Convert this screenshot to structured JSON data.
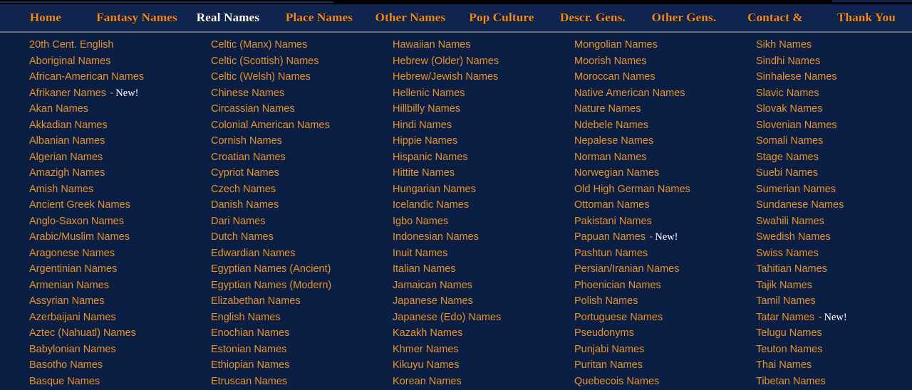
{
  "nav": {
    "items": [
      {
        "label": "Home",
        "active": false
      },
      {
        "label": "Fantasy Names",
        "active": false
      },
      {
        "label": "Real Names",
        "active": true
      },
      {
        "label": "Place Names",
        "active": false
      },
      {
        "label": "Other Names",
        "active": false
      },
      {
        "label": "Pop Culture",
        "active": false
      },
      {
        "label": "Descr. Gens.",
        "active": false
      },
      {
        "label": "Other Gens.",
        "active": false
      },
      {
        "label": "Contact &",
        "active": false
      },
      {
        "label": "Thank You",
        "active": false
      }
    ]
  },
  "colors": {
    "page_background": "#0b1f44",
    "nav_background": "#0f2550",
    "link_orange": "#e8922a",
    "nav_orange": "#f08a1e",
    "active_white": "#ffffff",
    "separator_grey": "#6b6f78",
    "top_strip_black": "#000000"
  },
  "badges": {
    "new_label": "New!",
    "dash": "-"
  },
  "columns": [
    {
      "links": [
        {
          "label": "20th Cent. English",
          "new": false
        },
        {
          "label": "Aboriginal Names",
          "new": false
        },
        {
          "label": "African-American Names",
          "new": false
        },
        {
          "label": "Afrikaner Names",
          "new": true
        },
        {
          "label": "Akan Names",
          "new": false
        },
        {
          "label": "Akkadian Names",
          "new": false
        },
        {
          "label": "Albanian Names",
          "new": false
        },
        {
          "label": "Algerian Names",
          "new": false
        },
        {
          "label": "Amazigh Names",
          "new": false
        },
        {
          "label": "Amish Names",
          "new": false
        },
        {
          "label": "Ancient Greek Names",
          "new": false
        },
        {
          "label": "Anglo-Saxon Names",
          "new": false
        },
        {
          "label": "Arabic/Muslim Names",
          "new": false
        },
        {
          "label": "Aragonese Names",
          "new": false
        },
        {
          "label": "Argentinian Names",
          "new": false
        },
        {
          "label": "Armenian Names",
          "new": false
        },
        {
          "label": "Assyrian Names",
          "new": false
        },
        {
          "label": "Azerbaijani Names",
          "new": false
        },
        {
          "label": "Aztec (Nahuatl) Names",
          "new": false
        },
        {
          "label": "Babylonian Names",
          "new": false
        },
        {
          "label": "Basotho Names",
          "new": false
        },
        {
          "label": "Basque Names",
          "new": false
        }
      ]
    },
    {
      "links": [
        {
          "label": "Celtic (Manx) Names",
          "new": false
        },
        {
          "label": "Celtic (Scottish) Names",
          "new": false
        },
        {
          "label": "Celtic (Welsh) Names",
          "new": false
        },
        {
          "label": "Chinese Names",
          "new": false
        },
        {
          "label": "Circassian Names",
          "new": false
        },
        {
          "label": "Colonial American Names",
          "new": false
        },
        {
          "label": "Cornish Names",
          "new": false
        },
        {
          "label": "Croatian Names",
          "new": false
        },
        {
          "label": "Cypriot Names",
          "new": false
        },
        {
          "label": "Czech Names",
          "new": false
        },
        {
          "label": "Danish Names",
          "new": false
        },
        {
          "label": "Dari Names",
          "new": false
        },
        {
          "label": "Dutch Names",
          "new": false
        },
        {
          "label": "Edwardian Names",
          "new": false
        },
        {
          "label": "Egyptian Names (Ancient)",
          "new": false
        },
        {
          "label": "Egyptian Names (Modern)",
          "new": false
        },
        {
          "label": "Elizabethan Names",
          "new": false
        },
        {
          "label": "English Names",
          "new": false
        },
        {
          "label": "Enochian Names",
          "new": false
        },
        {
          "label": "Estonian Names",
          "new": false
        },
        {
          "label": "Ethiopian Names",
          "new": false
        },
        {
          "label": "Etruscan Names",
          "new": false
        }
      ]
    },
    {
      "links": [
        {
          "label": "Hawaiian Names",
          "new": false
        },
        {
          "label": "Hebrew (Older) Names",
          "new": false
        },
        {
          "label": "Hebrew/Jewish Names",
          "new": false
        },
        {
          "label": "Hellenic Names",
          "new": false
        },
        {
          "label": "Hillbilly Names",
          "new": false
        },
        {
          "label": "Hindi Names",
          "new": false
        },
        {
          "label": "Hippie Names",
          "new": false
        },
        {
          "label": "Hispanic Names",
          "new": false
        },
        {
          "label": "Hittite Names",
          "new": false
        },
        {
          "label": "Hungarian Names",
          "new": false
        },
        {
          "label": "Icelandic Names",
          "new": false
        },
        {
          "label": "Igbo Names",
          "new": false
        },
        {
          "label": "Indonesian Names",
          "new": false
        },
        {
          "label": "Inuit Names",
          "new": false
        },
        {
          "label": "Italian Names",
          "new": false
        },
        {
          "label": "Jamaican Names",
          "new": false
        },
        {
          "label": "Japanese Names",
          "new": false
        },
        {
          "label": "Japanese (Edo) Names",
          "new": false
        },
        {
          "label": "Kazakh Names",
          "new": false
        },
        {
          "label": "Khmer Names",
          "new": false
        },
        {
          "label": "Kikuyu Names",
          "new": false
        },
        {
          "label": "Korean Names",
          "new": false
        }
      ]
    },
    {
      "links": [
        {
          "label": "Mongolian Names",
          "new": false
        },
        {
          "label": "Moorish Names",
          "new": false
        },
        {
          "label": "Moroccan Names",
          "new": false
        },
        {
          "label": "Native American Names",
          "new": false
        },
        {
          "label": "Nature Names",
          "new": false
        },
        {
          "label": "Ndebele Names",
          "new": false
        },
        {
          "label": "Nepalese Names",
          "new": false
        },
        {
          "label": "Norman Names",
          "new": false
        },
        {
          "label": "Norwegian Names",
          "new": false
        },
        {
          "label": "Old High German Names",
          "new": false
        },
        {
          "label": "Ottoman Names",
          "new": false
        },
        {
          "label": "Pakistani Names",
          "new": false
        },
        {
          "label": "Papuan Names",
          "new": true
        },
        {
          "label": "Pashtun Names",
          "new": false
        },
        {
          "label": "Persian/Iranian Names",
          "new": false
        },
        {
          "label": "Phoenician Names",
          "new": false
        },
        {
          "label": "Polish Names",
          "new": false
        },
        {
          "label": "Portuguese Names",
          "new": false
        },
        {
          "label": "Pseudonyms",
          "new": false
        },
        {
          "label": "Punjabi Names",
          "new": false
        },
        {
          "label": "Puritan Names",
          "new": false
        },
        {
          "label": "Quebecois Names",
          "new": false
        }
      ]
    },
    {
      "links": [
        {
          "label": "Sikh Names",
          "new": false
        },
        {
          "label": "Sindhi Names",
          "new": false
        },
        {
          "label": "Sinhalese Names",
          "new": false
        },
        {
          "label": "Slavic Names",
          "new": false
        },
        {
          "label": "Slovak Names",
          "new": false
        },
        {
          "label": "Slovenian Names",
          "new": false
        },
        {
          "label": "Somali Names",
          "new": false
        },
        {
          "label": "Stage Names",
          "new": false
        },
        {
          "label": "Suebi Names",
          "new": false
        },
        {
          "label": "Sumerian Names",
          "new": false
        },
        {
          "label": "Sundanese Names",
          "new": false
        },
        {
          "label": "Swahili Names",
          "new": false
        },
        {
          "label": "Swedish Names",
          "new": false
        },
        {
          "label": "Swiss Names",
          "new": false
        },
        {
          "label": "Tahitian Names",
          "new": false
        },
        {
          "label": "Tajik Names",
          "new": false
        },
        {
          "label": "Tamil Names",
          "new": false
        },
        {
          "label": "Tatar Names",
          "new": true
        },
        {
          "label": "Telugu Names",
          "new": false
        },
        {
          "label": "Teuton Names",
          "new": false
        },
        {
          "label": "Thai Names",
          "new": false
        },
        {
          "label": "Tibetan Names",
          "new": false
        }
      ]
    }
  ]
}
